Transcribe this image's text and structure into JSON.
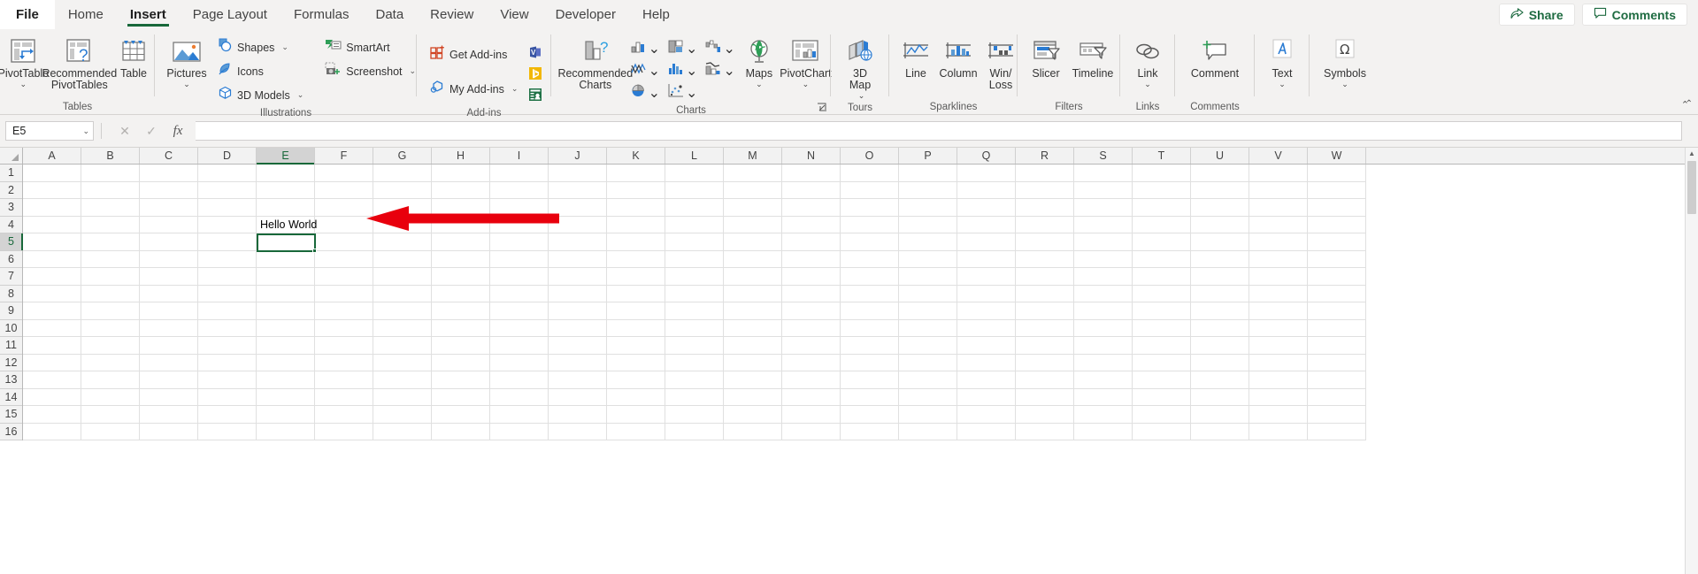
{
  "tabs": [
    {
      "label": "File",
      "state": "file"
    },
    {
      "label": "Home",
      "state": "normal"
    },
    {
      "label": "Insert",
      "state": "active"
    },
    {
      "label": "Page Layout",
      "state": "normal"
    },
    {
      "label": "Formulas",
      "state": "normal"
    },
    {
      "label": "Data",
      "state": "normal"
    },
    {
      "label": "Review",
      "state": "normal"
    },
    {
      "label": "View",
      "state": "normal"
    },
    {
      "label": "Developer",
      "state": "normal"
    },
    {
      "label": "Help",
      "state": "normal"
    }
  ],
  "titlebar": {
    "share_label": "Share",
    "share_icon": "share-icon",
    "comments_label": "Comments",
    "comments_icon": "comment-bubble-icon"
  },
  "ribbon": {
    "groups": [
      {
        "name": "tables",
        "label": "Tables",
        "big_buttons": [
          {
            "label": "PivotTable",
            "icon": "pivot-table-icon",
            "caret": true
          },
          {
            "label": "Recommended PivotTables",
            "icon": "recommended-pivot-tables-icon",
            "caret": false
          },
          {
            "label": "Table",
            "icon": "table-icon",
            "caret": false
          }
        ]
      },
      {
        "name": "illustrations",
        "label": "Illustrations",
        "big_buttons": [
          {
            "label": "Pictures",
            "icon": "pictures-icon",
            "caret": true
          }
        ],
        "small_columns": [
          [
            {
              "label": "Shapes",
              "icon": "shapes-icon",
              "caret": true
            },
            {
              "label": "Icons",
              "icon": "icons-icon",
              "caret": false
            },
            {
              "label": "3D Models",
              "icon": "3d-models-icon",
              "caret": true
            }
          ],
          [
            {
              "label": "SmartArt",
              "icon": "smartart-icon",
              "caret": false
            },
            {
              "label": "Screenshot",
              "icon": "screenshot-icon",
              "caret": true
            }
          ]
        ]
      },
      {
        "name": "add-ins",
        "label": "Add-ins",
        "small_columns": [
          [
            {
              "label": "Get Add-ins",
              "icon": "get-addins-icon",
              "caret": false
            },
            {
              "label": "My Add-ins",
              "icon": "my-addins-icon",
              "caret": true
            }
          ]
        ],
        "mini_icons": [
          "visio-addin-icon",
          "bing-maps-addin-icon",
          "people-graph-addin-icon"
        ]
      },
      {
        "name": "charts",
        "label": "Charts",
        "big_buttons": [
          {
            "label": "Recommended Charts",
            "icon": "recommended-charts-icon",
            "caret": false
          }
        ],
        "chart_grid": [
          "column-bar-chart-icon",
          "hierarchy-chart-icon",
          "waterfall-chart-icon",
          "line-area-chart-icon",
          "statistic-chart-icon",
          "combo-chart-icon",
          "pie-doughnut-chart-icon",
          "scatter-bubble-chart-icon",
          "blank-chart-icon"
        ],
        "big_buttons_right": [
          {
            "label": "Maps",
            "icon": "maps-globe-icon",
            "caret": true
          },
          {
            "label": "PivotChart",
            "icon": "pivot-chart-icon",
            "caret": true
          }
        ],
        "has_dialog_launcher": true
      },
      {
        "name": "tours",
        "label": "Tours",
        "big_buttons": [
          {
            "label": "3D Map",
            "icon": "3d-map-icon",
            "caret": true
          }
        ]
      },
      {
        "name": "sparklines",
        "label": "Sparklines",
        "big_buttons": [
          {
            "label": "Line",
            "icon": "sparkline-line-icon",
            "caret": false
          },
          {
            "label": "Column",
            "icon": "sparkline-column-icon",
            "caret": false
          },
          {
            "label": "Win/ Loss",
            "icon": "sparkline-winloss-icon",
            "caret": false
          }
        ]
      },
      {
        "name": "filters",
        "label": "Filters",
        "big_buttons": [
          {
            "label": "Slicer",
            "icon": "slicer-icon",
            "caret": false
          },
          {
            "label": "Timeline",
            "icon": "timeline-icon",
            "caret": false
          }
        ]
      },
      {
        "name": "links",
        "label": "Links",
        "big_buttons": [
          {
            "label": "Link",
            "icon": "link-icon",
            "caret": true
          }
        ]
      },
      {
        "name": "comments",
        "label": "Comments",
        "big_buttons": [
          {
            "label": "Comment",
            "icon": "new-comment-icon",
            "caret": false
          }
        ]
      },
      {
        "name": "text",
        "label": "",
        "big_buttons": [
          {
            "label": "Text",
            "icon": "text-box-icon",
            "caret": true
          }
        ]
      },
      {
        "name": "symbols",
        "label": "",
        "big_buttons": [
          {
            "label": "Symbols",
            "icon": "omega-symbol-icon",
            "caret": true
          }
        ]
      }
    ],
    "collapse_icon": "collapse-ribbon-icon"
  },
  "formula_bar": {
    "name_box_value": "E5",
    "name_box_caret": "chevron-down-icon",
    "cancel_icon": "cancel-icon",
    "enter_icon": "enter-check-icon",
    "function_icon": "insert-function-icon",
    "formula_value": "",
    "formula_placeholder": "",
    "expand_icon": "expand-formula-bar-icon"
  },
  "grid": {
    "columns": [
      "A",
      "B",
      "C",
      "D",
      "E",
      "F",
      "G",
      "H",
      "I",
      "J",
      "K",
      "L",
      "M",
      "N",
      "O",
      "P",
      "Q",
      "R",
      "S",
      "T",
      "U",
      "V",
      "W"
    ],
    "rows": [
      "1",
      "2",
      "3",
      "4",
      "5",
      "6",
      "7",
      "8",
      "9",
      "10",
      "11",
      "12",
      "13",
      "14",
      "15",
      "16"
    ],
    "selected_column": "E",
    "selected_row": "5",
    "selected_cell": "E5",
    "cell_values": [
      {
        "cell": "E4",
        "row": 4,
        "col": 5,
        "value": "Hello World"
      }
    ],
    "scroll": {
      "up_arrow": "scroll-up-arrow",
      "down_arrow": "scroll-down-arrow"
    }
  },
  "annotations": {
    "arrow": {
      "name": "red-arrow-annotation",
      "color": "#e8000d",
      "direction": "left",
      "points_to": "E4"
    }
  },
  "colors": {
    "accent_green": "#18683a",
    "ribbon_bg": "#f3f2f1",
    "annotation_red": "#e8000d"
  }
}
